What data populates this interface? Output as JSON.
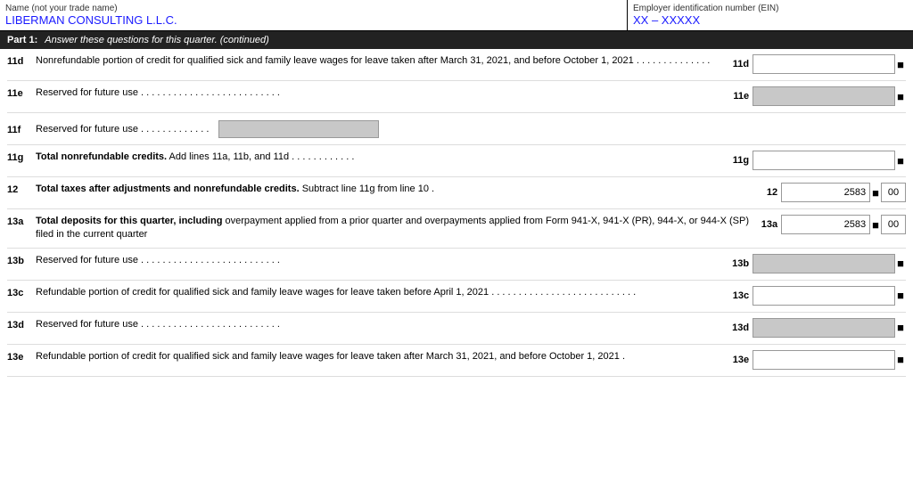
{
  "header": {
    "name_label": "Name (not your trade name)",
    "name_value": "LIBERMAN CONSULTING L.L.C.",
    "ein_label": "Employer identification number (EIN)",
    "ein_value": "XX – XXXXX"
  },
  "part1": {
    "label": "Part 1:",
    "question": "Answer these questions for this quarter. (continued)"
  },
  "rows": [
    {
      "id": "11d",
      "num": "11d",
      "desc": "Nonrefundable portion of credit for qualified sick and family leave wages for leave taken after March 31, 2021, and before October 1, 2021",
      "dots": ". . . . . . . . . . . . . .",
      "field_label": "11d",
      "has_amount": false,
      "value": "",
      "cents": "■",
      "gray": false
    },
    {
      "id": "11e",
      "num": "11e",
      "desc": "Reserved for future use",
      "dots": ". . . . . . . . . . . . . . . . . . . . . . . . . .",
      "field_label": "11e",
      "has_amount": false,
      "value": "",
      "cents": "■",
      "gray": true
    },
    {
      "id": "11f",
      "num": "11f",
      "desc": "Reserved for future use",
      "dots": ". . . . . . . . . . . . .",
      "field_label": "",
      "has_amount": false,
      "value": "",
      "cents": "",
      "gray": false,
      "special_gray_block": true
    },
    {
      "id": "11g",
      "num": "11g",
      "desc": "Total nonrefundable credits. Add lines 11a, 11b, and 11d",
      "dots": ". . . . . . . . . . . .",
      "field_label": "11g",
      "has_amount": false,
      "value": "",
      "cents": "■",
      "gray": false
    },
    {
      "id": "12",
      "num": "12",
      "desc_strong": "Total taxes after adjustments and nonrefundable credits.",
      "desc_rest": " Subtract line 11g from line 10",
      "dots": ".",
      "field_label": "12",
      "has_amount": true,
      "value": "2583",
      "cents": "00",
      "gray": false
    },
    {
      "id": "13a",
      "num": "13a",
      "desc_strong": "Total deposits for this quarter, including",
      "desc_rest": " overpayment applied from a prior quarter and overpayments applied from Form 941-X, 941-X (PR), 944-X, or 944-X (SP) filed in the current quarter",
      "dots": "",
      "field_label": "13a",
      "has_amount": true,
      "value": "2583",
      "cents": "00",
      "gray": false
    },
    {
      "id": "13b",
      "num": "13b",
      "desc": "Reserved for future use",
      "dots": ". . . . . . . . . . . . . . . . . . . . . . . . . .",
      "field_label": "13b",
      "has_amount": false,
      "value": "",
      "cents": "■",
      "gray": true
    },
    {
      "id": "13c",
      "num": "13c",
      "desc": "Refundable portion of credit for qualified sick and family leave wages for leave taken before April 1, 2021",
      "dots": ". . . . . . . . . . . . . . . . . . . . . . . . . . .",
      "field_label": "13c",
      "has_amount": false,
      "value": "",
      "cents": "■",
      "gray": false
    },
    {
      "id": "13d",
      "num": "13d",
      "desc": "Reserved for future use",
      "dots": ". . . . . . . . . . . . . . . . . . . . . . . . . .",
      "field_label": "13d",
      "has_amount": false,
      "value": "",
      "cents": "■",
      "gray": true
    },
    {
      "id": "13e",
      "num": "13e",
      "desc": "Refundable portion of credit for qualified sick and family leave wages for leave taken after March 31, 2021, and before October 1, 2021",
      "dots": ".",
      "field_label": "13e",
      "has_amount": false,
      "value": "",
      "cents": "■",
      "gray": false
    }
  ]
}
